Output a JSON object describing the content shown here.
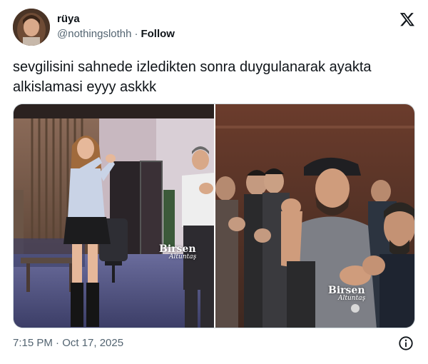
{
  "tweet": {
    "display_name": "rüya",
    "handle": "@nothingslothh",
    "separator": "·",
    "follow_label": "Follow",
    "text": "sevgilisini sahnede izledikten sonra duygulanarak ayakta alkislamasi eyyy askkk",
    "timestamp": "7:15 PM · Oct 17, 2025"
  },
  "media": {
    "left_watermark": "Birsen",
    "left_watermark_sub": "Altuntaş",
    "right_watermark": "Birsen",
    "right_watermark_sub": "Altuntaş"
  },
  "icons": {
    "brand": "x-logo-icon",
    "info": "info-icon"
  },
  "colors": {
    "text_primary": "#0f1419",
    "text_secondary": "#536471",
    "border": "#cfd9de"
  }
}
